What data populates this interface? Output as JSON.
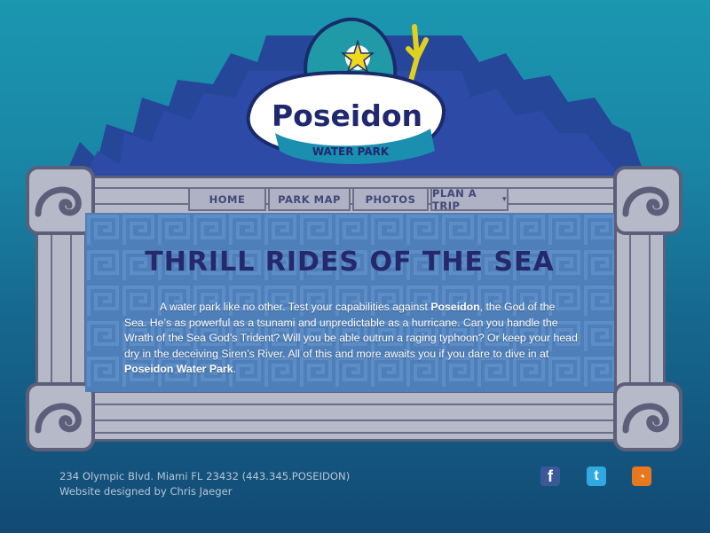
{
  "logo": {
    "name_line": "Poseidon",
    "sub_line": "WATER PARK"
  },
  "nav": {
    "items": [
      {
        "label": "HOME"
      },
      {
        "label": "PARK MAP"
      },
      {
        "label": "PHOTOS"
      },
      {
        "label": "PLAN A TRIP"
      }
    ],
    "dropdown_indicator": "▾"
  },
  "main": {
    "title": "THRILL RIDES OF THE SEA",
    "paragraph": {
      "part1": "A water park like no other. Test your capabilities against ",
      "bold1": "Poseidon",
      "part2": ", the God of the Sea. He’s as powerful as a tsunami and unpredictable as a hurricane. Can you handle the Wrath of the Sea God’s Trident? Will you be able outrun a raging typhoon? Or keep your head dry in the deceiving Siren’s River. All of this and more awaits you if you dare to dive in at ",
      "bold2": "Poseidon Water Park",
      "part3": "."
    }
  },
  "footer": {
    "address": "234 Olympic Blvd. Miami FL 23432 (443.345.POSEIDON)",
    "credit": "Website designed by Chris Jaeger"
  },
  "social": [
    {
      "name": "facebook-icon",
      "glyph": "f",
      "color": "#3b5998"
    },
    {
      "name": "twitter-icon",
      "glyph": "t",
      "color": "#2fa9e0"
    },
    {
      "name": "rss-icon",
      "glyph": "◔",
      "color": "#e8781e"
    }
  ],
  "colors": {
    "accent": "#25286a",
    "stone": "#b5b9c8",
    "panel": "#4f7fb9"
  }
}
